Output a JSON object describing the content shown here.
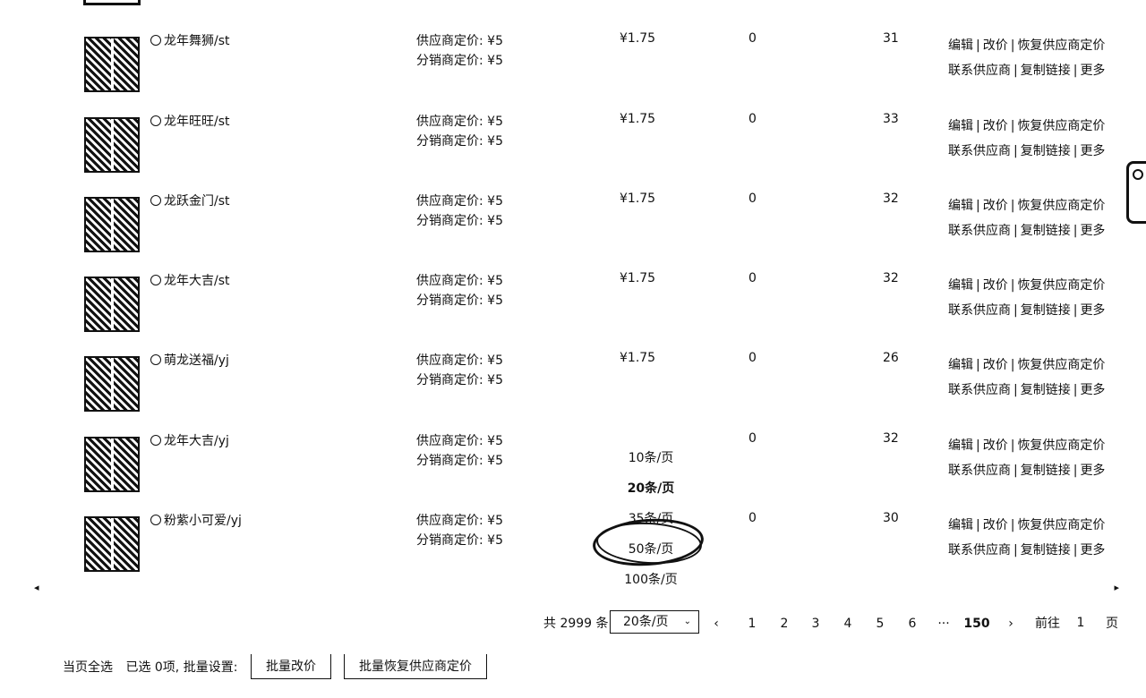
{
  "rows": [
    {
      "name": "龙年舞狮/st",
      "supply_price": "供应商定价: ¥5",
      "dist_price": "分销商定价: ¥5",
      "price": "¥1.75",
      "c1": "0",
      "c2": "31"
    },
    {
      "name": "龙年旺旺/st",
      "supply_price": "供应商定价: ¥5",
      "dist_price": "分销商定价: ¥5",
      "price": "¥1.75",
      "c1": "0",
      "c2": "33"
    },
    {
      "name": "龙跃金门/st",
      "supply_price": "供应商定价: ¥5",
      "dist_price": "分销商定价: ¥5",
      "price": "¥1.75",
      "c1": "0",
      "c2": "32"
    },
    {
      "name": "龙年大吉/st",
      "supply_price": "供应商定价: ¥5",
      "dist_price": "分销商定价: ¥5",
      "price": "¥1.75",
      "c1": "0",
      "c2": "32"
    },
    {
      "name": "萌龙送福/yj",
      "supply_price": "供应商定价: ¥5",
      "dist_price": "分销商定价: ¥5",
      "price": "¥1.75",
      "c1": "0",
      "c2": "26"
    },
    {
      "name": "龙年大吉/yj",
      "supply_price": "供应商定价: ¥5",
      "dist_price": "分销商定价: ¥5",
      "price": "",
      "c1": "0",
      "c2": "32"
    },
    {
      "name": "粉紫小可爱/yj",
      "supply_price": "供应商定价: ¥5",
      "dist_price": "分销商定价: ¥5",
      "price": "",
      "c1": "0",
      "c2": "30"
    }
  ],
  "ops": {
    "edit": "编辑",
    "reprice": "改价",
    "restore": "恢复供应商定价",
    "contact": "联系供应商",
    "copy_link": "复制链接",
    "more": "更多",
    "sep": "|"
  },
  "dropdown": {
    "options": [
      "10条/页",
      "20条/页",
      "35条/页",
      "50条/页",
      "100条/页"
    ]
  },
  "pager": {
    "total": "共 2999 条",
    "page_size": "20条/页",
    "prev": "‹",
    "pages": [
      "1",
      "2",
      "3",
      "4",
      "5",
      "6",
      "···",
      "150"
    ],
    "next": "›",
    "goto_label": "前往",
    "goto_value": "1",
    "goto_suffix": "页"
  },
  "bottom": {
    "select_all": "当页全选",
    "selected": "已选 0项, 批量设置:",
    "batch_reprice": "批量改价",
    "batch_restore": "批量恢复供应商定价"
  }
}
